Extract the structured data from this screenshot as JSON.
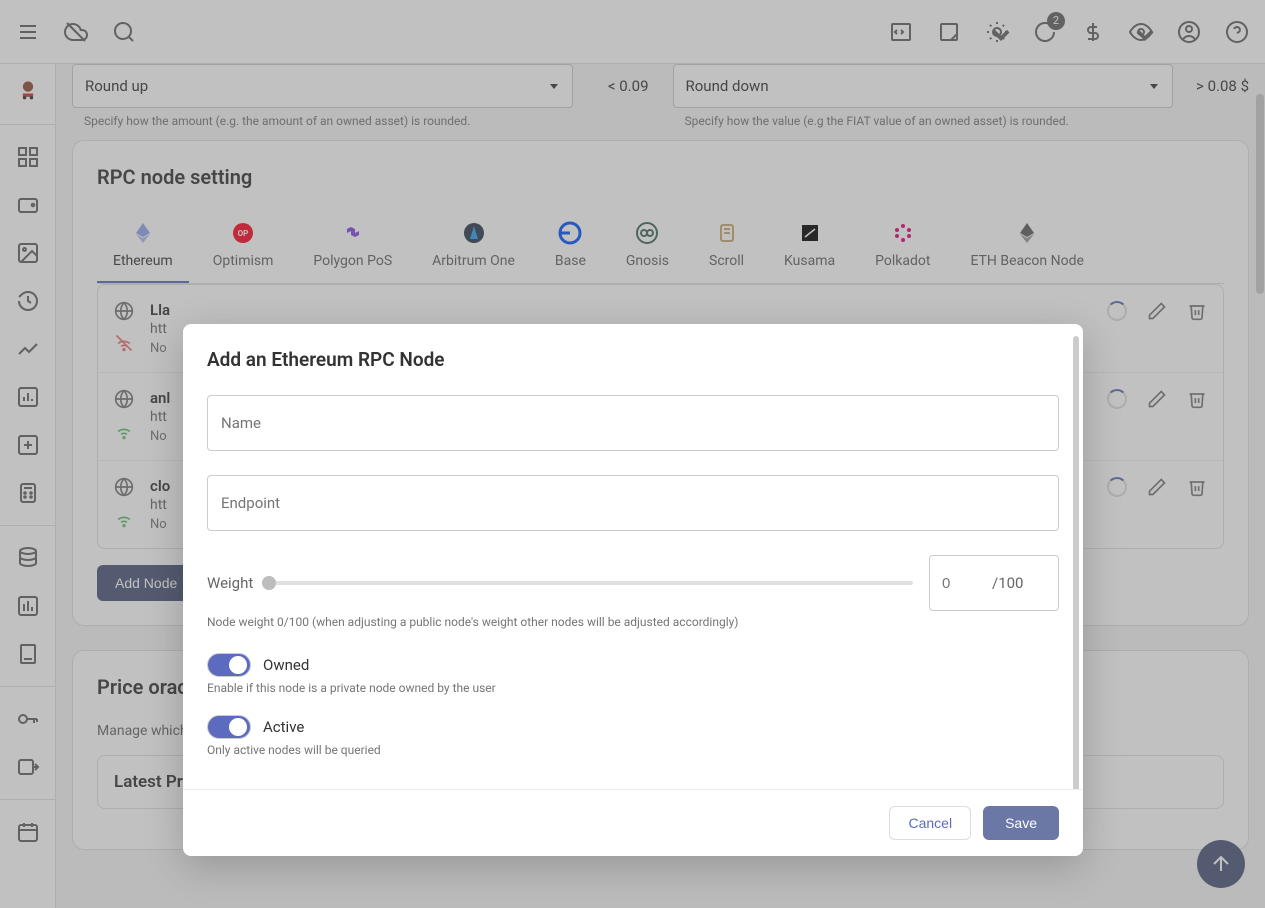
{
  "topbar": {
    "badge_count": "2"
  },
  "rounding": {
    "amount_value": "Round up",
    "amount_example": "< 0.09",
    "amount_hint": "Specify how the amount (e.g. the amount of an owned asset) is rounded.",
    "value_value": "Round down",
    "value_example": "> 0.08 $",
    "value_hint": "Specify how the value (e.g the FIAT value of an owned asset) is rounded."
  },
  "rpc": {
    "title": "RPC node setting",
    "tabs": [
      "Ethereum",
      "Optimism",
      "Polygon PoS",
      "Arbitrum One",
      "Base",
      "Gnosis",
      "Scroll",
      "Kusama",
      "Polkadot",
      "ETH Beacon Node"
    ],
    "nodes": [
      {
        "name": "Lla",
        "url": "htt",
        "status": "No"
      },
      {
        "name": "anl",
        "url": "htt",
        "status": "No"
      },
      {
        "name": "clo",
        "url": "htt",
        "status": "No"
      }
    ],
    "add_label": "Add Node"
  },
  "oracle": {
    "title": "Price oracl",
    "desc": "Manage which",
    "latest_title": "Latest Pr"
  },
  "dialog": {
    "title": "Add an Ethereum RPC Node",
    "name_label": "Name",
    "endpoint_label": "Endpoint",
    "weight_label": "Weight",
    "weight_value": "0",
    "weight_suffix": "/100",
    "weight_hint": "Node weight 0/100 (when adjusting a public node's weight other nodes will be adjusted accordingly)",
    "owned_label": "Owned",
    "owned_hint": "Enable if this node is a private node owned by the user",
    "active_label": "Active",
    "active_hint": "Only active nodes will be queried",
    "cancel": "Cancel",
    "save": "Save"
  }
}
